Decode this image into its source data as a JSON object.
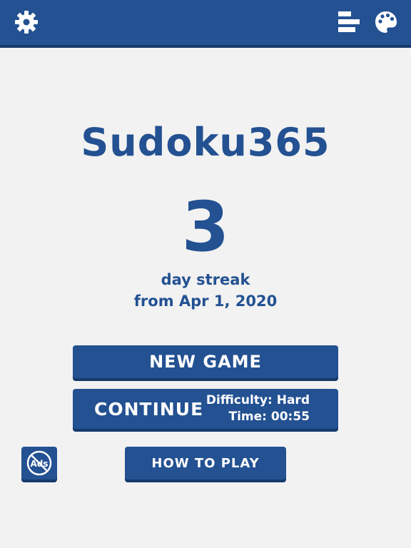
{
  "app": {
    "title": "Sudoku365"
  },
  "header": {
    "settings_icon": "gear-icon",
    "stats_icon": "bar-chart-icon",
    "theme_icon": "palette-icon"
  },
  "streak": {
    "count": "3",
    "label": "day streak",
    "since": "from Apr 1, 2020"
  },
  "buttons": {
    "new_game": "NEW GAME",
    "continue": "CONTINUE",
    "difficulty": "Difficulty: Hard",
    "time": "Time: 00:55",
    "how_to_play": "HOW TO PLAY",
    "no_ads_icon_label": "Ads"
  },
  "colors": {
    "primary": "#235192",
    "primary_dark": "#163a6b",
    "background": "#f2f2f2",
    "text_on_primary": "#ffffff"
  }
}
